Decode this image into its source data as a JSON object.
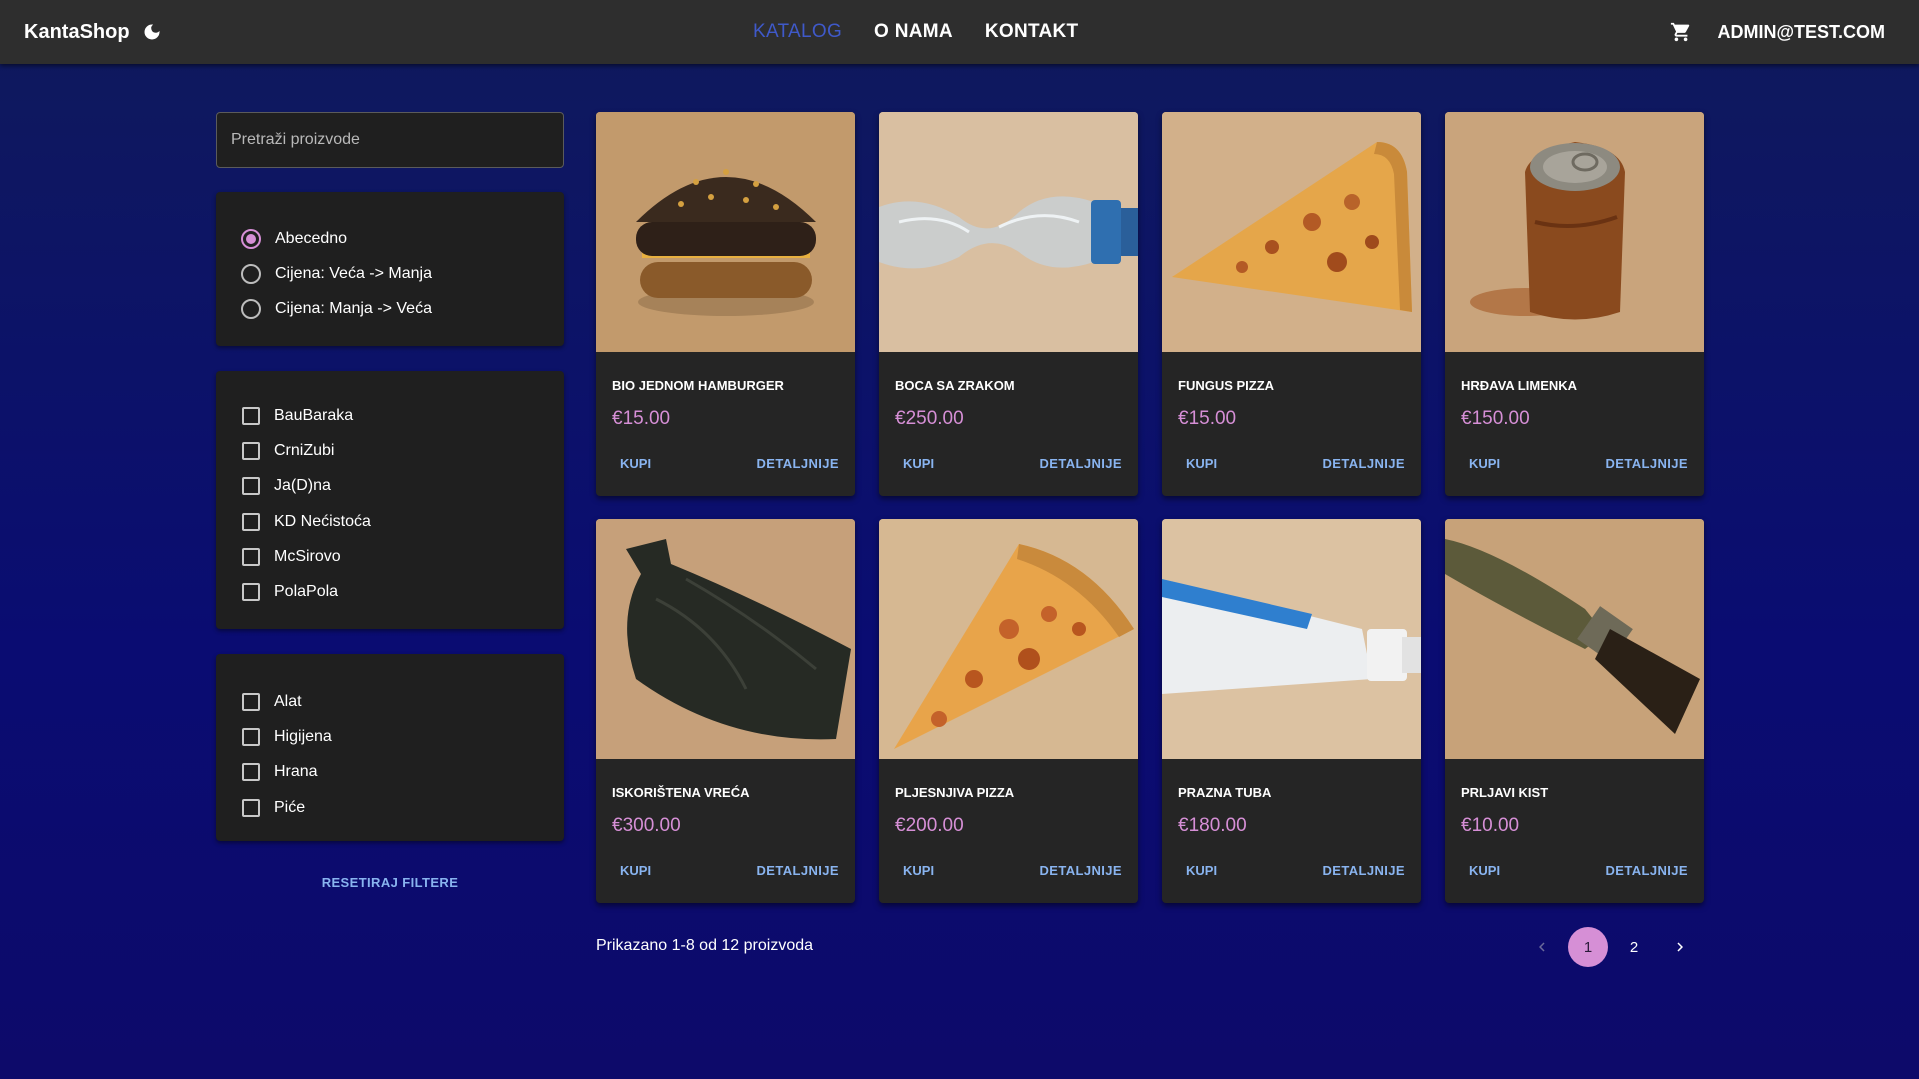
{
  "navbar": {
    "brand": "KantaShop",
    "theme_icon": "moon-icon",
    "links": [
      {
        "label": "KATALOG",
        "active": true
      },
      {
        "label": "O NAMA",
        "active": false
      },
      {
        "label": "KONTAKT",
        "active": false
      }
    ],
    "cart_icon": "cart-icon",
    "user": "ADMIN@TEST.COM",
    "accent_color": "#3f59c9"
  },
  "sidebar": {
    "search_placeholder": "Pretraži proizvode",
    "search_value": "",
    "sort_options": [
      {
        "label": "Abecedno",
        "checked": true
      },
      {
        "label": "Cijena: Veća -> Manja",
        "checked": false
      },
      {
        "label": "Cijena: Manja -> Veća",
        "checked": false
      }
    ],
    "brands": [
      {
        "label": "BauBaraka",
        "checked": false
      },
      {
        "label": "CrniZubi",
        "checked": false
      },
      {
        "label": "Ja(D)na",
        "checked": false
      },
      {
        "label": "KD Nećistoća",
        "checked": false
      },
      {
        "label": "McSirovo",
        "checked": false
      },
      {
        "label": "PolaPola",
        "checked": false
      }
    ],
    "categories": [
      {
        "label": "Alat",
        "checked": false
      },
      {
        "label": "Higijena",
        "checked": false
      },
      {
        "label": "Hrana",
        "checked": false
      },
      {
        "label": "Piće",
        "checked": false
      }
    ],
    "reset_label": "RESETIRAJ FILTERE"
  },
  "products": [
    {
      "title": "BIO JEDNOM HAMBURGER",
      "price": "€15.00",
      "buy": "KUPI",
      "details": "DETALJNIJE",
      "image": "burger"
    },
    {
      "title": "BOCA SA ZRAKOM",
      "price": "€250.00",
      "buy": "KUPI",
      "details": "DETALJNIJE",
      "image": "bottle"
    },
    {
      "title": "FUNGUS PIZZA",
      "price": "€15.00",
      "buy": "KUPI",
      "details": "DETALJNIJE",
      "image": "pizza"
    },
    {
      "title": "HRĐAVA LIMENKA",
      "price": "€150.00",
      "buy": "KUPI",
      "details": "DETALJNIJE",
      "image": "can"
    },
    {
      "title": "ISKORIŠTENA VREĆA",
      "price": "€300.00",
      "buy": "KUPI",
      "details": "DETALJNIJE",
      "image": "bag"
    },
    {
      "title": "PLJESNJIVA PIZZA",
      "price": "€200.00",
      "buy": "KUPI",
      "details": "DETALJNIJE",
      "image": "pizza2"
    },
    {
      "title": "PRAZNA TUBA",
      "price": "€180.00",
      "buy": "KUPI",
      "details": "DETALJNIJE",
      "image": "tube"
    },
    {
      "title": "PRLJAVI KIST",
      "price": "€10.00",
      "buy": "KUPI",
      "details": "DETALJNIJE",
      "image": "brush"
    }
  ],
  "footer": {
    "results": "Prikazano 1-8 od 12 proizvoda",
    "pages": [
      "1",
      "2"
    ],
    "current_page": "1",
    "prev_icon": "chevron-left-icon",
    "next_icon": "chevron-right-icon"
  },
  "colors": {
    "price": "#d68fd6",
    "button_text": "#89b4f0",
    "card_bg": "#252525"
  }
}
